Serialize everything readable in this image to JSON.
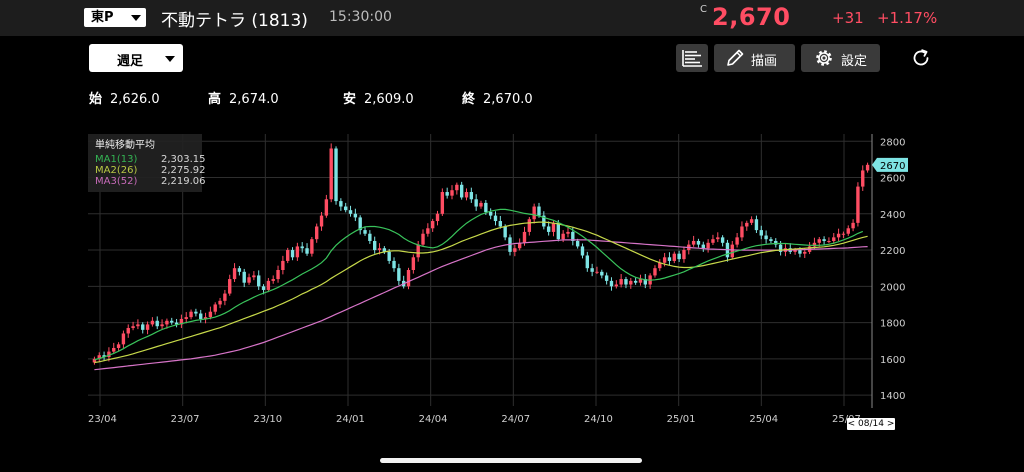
{
  "header": {
    "market": "東P",
    "name": "不動テトラ (1813)",
    "time": "15:30:00",
    "price_flag": "C",
    "price": "2,670",
    "change": "+31",
    "change_pct": "+1.17%"
  },
  "toolbar": {
    "period": "週足",
    "draw_label": "描画",
    "settings_label": "設定"
  },
  "ohlc": {
    "open_label": "始",
    "open": "2,626.0",
    "high_label": "高",
    "high": "2,674.0",
    "low_label": "安",
    "low": "2,609.0",
    "close_label": "終",
    "close": "2,670.0"
  },
  "legend": {
    "title": "単純移動平均",
    "ma1_label": "MA1(13)",
    "ma1_value": "2,303.15",
    "ma2_label": "MA2(26)",
    "ma2_value": "2,275.92",
    "ma3_label": "MA3(52)",
    "ma3_value": "2,219.06"
  },
  "date_badge": "< 08/14 >",
  "colors": {
    "up": "#ff4d63",
    "down": "#7ee4e4",
    "ma1": "#39c35b",
    "ma2": "#c7d94a",
    "ma3": "#d774c8",
    "price": "#ff4d63"
  },
  "chart_data": {
    "type": "candlestick",
    "x_ticks": [
      "23/04",
      "23/07",
      "23/10",
      "24/01",
      "24/04",
      "24/07",
      "24/10",
      "25/01",
      "25/04",
      "25/07"
    ],
    "y_ticks": [
      1400,
      1600,
      1800,
      2000,
      2200,
      2400,
      2600,
      2800
    ],
    "ylim": [
      1340,
      2840
    ],
    "last_price_label": "2670",
    "close": [
      1600,
      1620,
      1610,
      1640,
      1660,
      1680,
      1740,
      1770,
      1780,
      1790,
      1760,
      1790,
      1810,
      1780,
      1790,
      1810,
      1800,
      1790,
      1820,
      1830,
      1860,
      1850,
      1820,
      1830,
      1860,
      1900,
      1920,
      1960,
      2040,
      2100,
      2080,
      2020,
      2050,
      2060,
      2000,
      1980,
      2030,
      2040,
      2090,
      2140,
      2200,
      2160,
      2220,
      2210,
      2180,
      2260,
      2330,
      2390,
      2480,
      2760,
      2470,
      2440,
      2420,
      2400,
      2380,
      2310,
      2290,
      2250,
      2200,
      2210,
      2190,
      2140,
      2100,
      2030,
      2000,
      2090,
      2160,
      2230,
      2290,
      2320,
      2360,
      2400,
      2520,
      2500,
      2530,
      2560,
      2490,
      2520,
      2480,
      2440,
      2460,
      2410,
      2390,
      2360,
      2330,
      2270,
      2190,
      2210,
      2240,
      2300,
      2370,
      2440,
      2390,
      2330,
      2300,
      2350,
      2260,
      2290,
      2300,
      2250,
      2220,
      2170,
      2100,
      2080,
      2080,
      2060,
      2030,
      2000,
      2010,
      2040,
      2010,
      2030,
      2020,
      2040,
      2010,
      2060,
      2100,
      2130,
      2160,
      2140,
      2180,
      2150,
      2200,
      2230,
      2250,
      2230,
      2210,
      2240,
      2260,
      2270,
      2240,
      2160,
      2230,
      2270,
      2330,
      2350,
      2370,
      2310,
      2280,
      2260,
      2250,
      2230,
      2190,
      2210,
      2190,
      2200,
      2180,
      2190,
      2220,
      2240,
      2260,
      2250,
      2250,
      2270,
      2290,
      2290,
      2320,
      2350,
      2550,
      2639,
      2670
    ],
    "ma1": [
      1595,
      1602,
      1610,
      1620,
      1630,
      1642,
      1656,
      1672,
      1686,
      1700,
      1712,
      1724,
      1736,
      1750,
      1762,
      1772,
      1780,
      1788,
      1794,
      1800,
      1806,
      1812,
      1816,
      1820,
      1824,
      1830,
      1840,
      1852,
      1866,
      1884,
      1900,
      1914,
      1926,
      1940,
      1952,
      1962,
      1972,
      1982,
      1994,
      2008,
      2022,
      2036,
      2052,
      2068,
      2082,
      2096,
      2112,
      2130,
      2156,
      2196,
      2226,
      2250,
      2270,
      2288,
      2304,
      2318,
      2328,
      2330,
      2330,
      2326,
      2320,
      2312,
      2300,
      2286,
      2266,
      2250,
      2238,
      2228,
      2220,
      2216,
      2212,
      2218,
      2232,
      2252,
      2276,
      2302,
      2326,
      2348,
      2366,
      2382,
      2396,
      2406,
      2414,
      2420,
      2424,
      2424,
      2420,
      2414,
      2408,
      2402,
      2398,
      2394,
      2388,
      2380,
      2372,
      2364,
      2352,
      2340,
      2326,
      2310,
      2294,
      2276,
      2256,
      2236,
      2214,
      2190,
      2166,
      2142,
      2118,
      2096,
      2078,
      2062,
      2050,
      2042,
      2036,
      2034,
      2036,
      2040,
      2046,
      2054,
      2062,
      2070,
      2080,
      2092,
      2104,
      2116,
      2128,
      2140,
      2150,
      2160,
      2170,
      2178,
      2186,
      2194,
      2202,
      2210,
      2218,
      2224,
      2228,
      2232,
      2234,
      2236,
      2236,
      2236,
      2234,
      2232,
      2230,
      2228,
      2226,
      2226,
      2226,
      2228,
      2232,
      2238,
      2246,
      2256,
      2266,
      2278,
      2292,
      2303
    ],
    "ma2": [
      1580,
      1584,
      1590,
      1596,
      1602,
      1608,
      1614,
      1620,
      1628,
      1636,
      1644,
      1652,
      1660,
      1668,
      1676,
      1684,
      1692,
      1700,
      1708,
      1716,
      1724,
      1732,
      1740,
      1748,
      1756,
      1764,
      1772,
      1782,
      1792,
      1802,
      1812,
      1822,
      1832,
      1842,
      1852,
      1862,
      1872,
      1882,
      1894,
      1906,
      1918,
      1930,
      1944,
      1958,
      1970,
      1984,
      1996,
      2010,
      2026,
      2044,
      2060,
      2076,
      2092,
      2108,
      2124,
      2140,
      2154,
      2166,
      2176,
      2184,
      2190,
      2194,
      2196,
      2196,
      2192,
      2188,
      2186,
      2184,
      2184,
      2186,
      2190,
      2196,
      2204,
      2214,
      2224,
      2236,
      2248,
      2258,
      2268,
      2278,
      2288,
      2298,
      2308,
      2316,
      2324,
      2330,
      2336,
      2340,
      2344,
      2348,
      2350,
      2352,
      2354,
      2354,
      2352,
      2348,
      2344,
      2338,
      2332,
      2326,
      2318,
      2310,
      2302,
      2292,
      2282,
      2270,
      2258,
      2246,
      2234,
      2222,
      2210,
      2198,
      2186,
      2174,
      2162,
      2150,
      2140,
      2130,
      2122,
      2116,
      2110,
      2106,
      2104,
      2104,
      2106,
      2110,
      2114,
      2120,
      2126,
      2132,
      2138,
      2144,
      2150,
      2156,
      2162,
      2168,
      2174,
      2180,
      2186,
      2190,
      2194,
      2198,
      2200,
      2202,
      2204,
      2206,
      2208,
      2210,
      2212,
      2214,
      2216,
      2218,
      2222,
      2226,
      2232,
      2238,
      2246,
      2254,
      2262,
      2270,
      2276
    ],
    "ma3": [
      1540,
      1543,
      1546,
      1549,
      1552,
      1555,
      1558,
      1561,
      1564,
      1567,
      1570,
      1573,
      1576,
      1579,
      1582,
      1585,
      1588,
      1591,
      1594,
      1597,
      1600,
      1604,
      1608,
      1612,
      1616,
      1620,
      1626,
      1632,
      1638,
      1644,
      1650,
      1658,
      1666,
      1674,
      1682,
      1690,
      1700,
      1710,
      1720,
      1730,
      1740,
      1750,
      1760,
      1770,
      1780,
      1790,
      1800,
      1810,
      1822,
      1834,
      1846,
      1858,
      1870,
      1882,
      1894,
      1906,
      1918,
      1930,
      1942,
      1954,
      1966,
      1978,
      1990,
      2002,
      2014,
      2026,
      2038,
      2050,
      2062,
      2074,
      2086,
      2098,
      2110,
      2120,
      2130,
      2140,
      2150,
      2160,
      2170,
      2180,
      2190,
      2200,
      2208,
      2216,
      2222,
      2228,
      2232,
      2236,
      2238,
      2240,
      2242,
      2244,
      2246,
      2248,
      2250,
      2252,
      2254,
      2256,
      2256,
      2256,
      2256,
      2256,
      2256,
      2254,
      2252,
      2250,
      2248,
      2246,
      2244,
      2242,
      2240,
      2238,
      2236,
      2234,
      2232,
      2230,
      2228,
      2226,
      2224,
      2222,
      2220,
      2218,
      2216,
      2214,
      2212,
      2210,
      2208,
      2206,
      2205,
      2204,
      2203,
      2202,
      2201,
      2200,
      2200,
      2200,
      2200,
      2200,
      2200,
      2200,
      2200,
      2200,
      2200,
      2200,
      2200,
      2201,
      2202,
      2203,
      2204,
      2205,
      2206,
      2207,
      2208,
      2209,
      2210,
      2211,
      2212,
      2214,
      2216,
      2218,
      2219
    ]
  }
}
